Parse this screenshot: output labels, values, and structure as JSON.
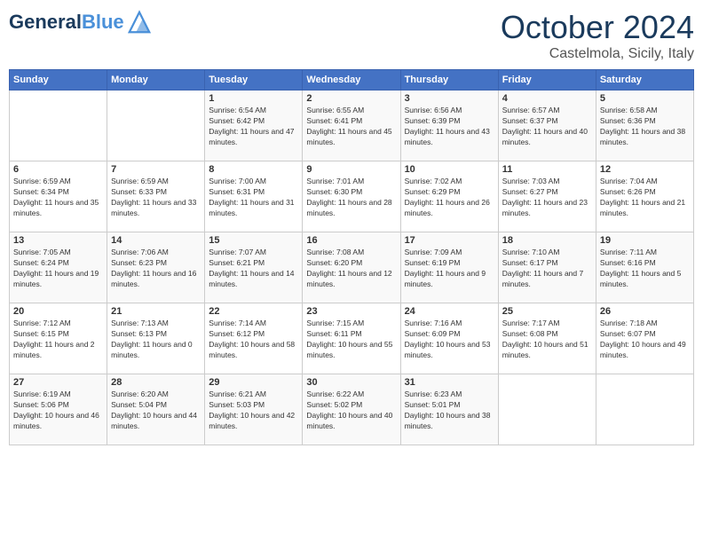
{
  "logo": {
    "line1": "General",
    "line2": "Blue"
  },
  "title": "October 2024",
  "subtitle": "Castelmola, Sicily, Italy",
  "days_of_week": [
    "Sunday",
    "Monday",
    "Tuesday",
    "Wednesday",
    "Thursday",
    "Friday",
    "Saturday"
  ],
  "weeks": [
    [
      {
        "day": "",
        "content": ""
      },
      {
        "day": "",
        "content": ""
      },
      {
        "day": "1",
        "content": "Sunrise: 6:54 AM\nSunset: 6:42 PM\nDaylight: 11 hours and 47 minutes."
      },
      {
        "day": "2",
        "content": "Sunrise: 6:55 AM\nSunset: 6:41 PM\nDaylight: 11 hours and 45 minutes."
      },
      {
        "day": "3",
        "content": "Sunrise: 6:56 AM\nSunset: 6:39 PM\nDaylight: 11 hours and 43 minutes."
      },
      {
        "day": "4",
        "content": "Sunrise: 6:57 AM\nSunset: 6:37 PM\nDaylight: 11 hours and 40 minutes."
      },
      {
        "day": "5",
        "content": "Sunrise: 6:58 AM\nSunset: 6:36 PM\nDaylight: 11 hours and 38 minutes."
      }
    ],
    [
      {
        "day": "6",
        "content": "Sunrise: 6:59 AM\nSunset: 6:34 PM\nDaylight: 11 hours and 35 minutes."
      },
      {
        "day": "7",
        "content": "Sunrise: 6:59 AM\nSunset: 6:33 PM\nDaylight: 11 hours and 33 minutes."
      },
      {
        "day": "8",
        "content": "Sunrise: 7:00 AM\nSunset: 6:31 PM\nDaylight: 11 hours and 31 minutes."
      },
      {
        "day": "9",
        "content": "Sunrise: 7:01 AM\nSunset: 6:30 PM\nDaylight: 11 hours and 28 minutes."
      },
      {
        "day": "10",
        "content": "Sunrise: 7:02 AM\nSunset: 6:29 PM\nDaylight: 11 hours and 26 minutes."
      },
      {
        "day": "11",
        "content": "Sunrise: 7:03 AM\nSunset: 6:27 PM\nDaylight: 11 hours and 23 minutes."
      },
      {
        "day": "12",
        "content": "Sunrise: 7:04 AM\nSunset: 6:26 PM\nDaylight: 11 hours and 21 minutes."
      }
    ],
    [
      {
        "day": "13",
        "content": "Sunrise: 7:05 AM\nSunset: 6:24 PM\nDaylight: 11 hours and 19 minutes."
      },
      {
        "day": "14",
        "content": "Sunrise: 7:06 AM\nSunset: 6:23 PM\nDaylight: 11 hours and 16 minutes."
      },
      {
        "day": "15",
        "content": "Sunrise: 7:07 AM\nSunset: 6:21 PM\nDaylight: 11 hours and 14 minutes."
      },
      {
        "day": "16",
        "content": "Sunrise: 7:08 AM\nSunset: 6:20 PM\nDaylight: 11 hours and 12 minutes."
      },
      {
        "day": "17",
        "content": "Sunrise: 7:09 AM\nSunset: 6:19 PM\nDaylight: 11 hours and 9 minutes."
      },
      {
        "day": "18",
        "content": "Sunrise: 7:10 AM\nSunset: 6:17 PM\nDaylight: 11 hours and 7 minutes."
      },
      {
        "day": "19",
        "content": "Sunrise: 7:11 AM\nSunset: 6:16 PM\nDaylight: 11 hours and 5 minutes."
      }
    ],
    [
      {
        "day": "20",
        "content": "Sunrise: 7:12 AM\nSunset: 6:15 PM\nDaylight: 11 hours and 2 minutes."
      },
      {
        "day": "21",
        "content": "Sunrise: 7:13 AM\nSunset: 6:13 PM\nDaylight: 11 hours and 0 minutes."
      },
      {
        "day": "22",
        "content": "Sunrise: 7:14 AM\nSunset: 6:12 PM\nDaylight: 10 hours and 58 minutes."
      },
      {
        "day": "23",
        "content": "Sunrise: 7:15 AM\nSunset: 6:11 PM\nDaylight: 10 hours and 55 minutes."
      },
      {
        "day": "24",
        "content": "Sunrise: 7:16 AM\nSunset: 6:09 PM\nDaylight: 10 hours and 53 minutes."
      },
      {
        "day": "25",
        "content": "Sunrise: 7:17 AM\nSunset: 6:08 PM\nDaylight: 10 hours and 51 minutes."
      },
      {
        "day": "26",
        "content": "Sunrise: 7:18 AM\nSunset: 6:07 PM\nDaylight: 10 hours and 49 minutes."
      }
    ],
    [
      {
        "day": "27",
        "content": "Sunrise: 6:19 AM\nSunset: 5:06 PM\nDaylight: 10 hours and 46 minutes."
      },
      {
        "day": "28",
        "content": "Sunrise: 6:20 AM\nSunset: 5:04 PM\nDaylight: 10 hours and 44 minutes."
      },
      {
        "day": "29",
        "content": "Sunrise: 6:21 AM\nSunset: 5:03 PM\nDaylight: 10 hours and 42 minutes."
      },
      {
        "day": "30",
        "content": "Sunrise: 6:22 AM\nSunset: 5:02 PM\nDaylight: 10 hours and 40 minutes."
      },
      {
        "day": "31",
        "content": "Sunrise: 6:23 AM\nSunset: 5:01 PM\nDaylight: 10 hours and 38 minutes."
      },
      {
        "day": "",
        "content": ""
      },
      {
        "day": "",
        "content": ""
      }
    ]
  ]
}
